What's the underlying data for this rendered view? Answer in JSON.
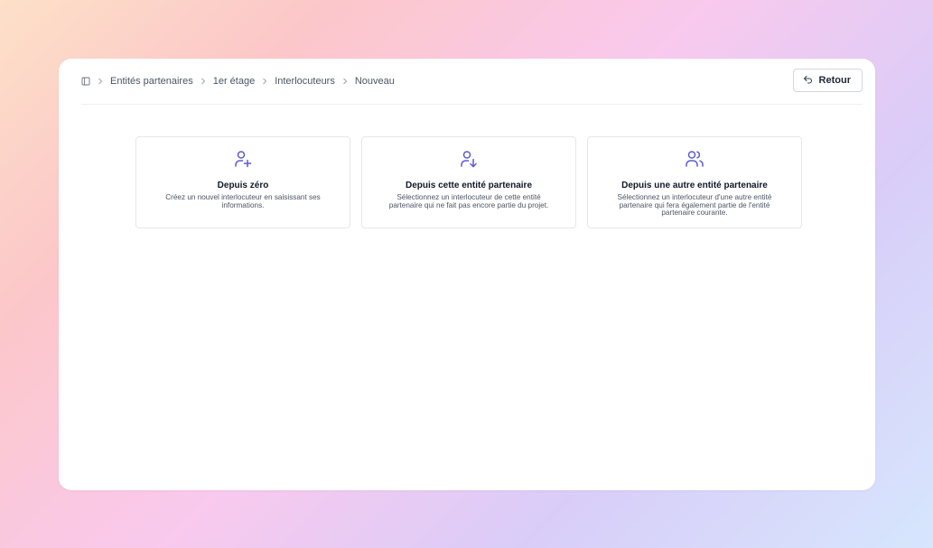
{
  "breadcrumb": {
    "home_icon": "panel-icon",
    "items": [
      "Entités partenaires",
      "1er étage",
      "Interlocuteurs",
      "Nouveau"
    ]
  },
  "back_button": {
    "label": "Retour",
    "icon": "undo-arrow-icon"
  },
  "options": [
    {
      "icon": "user-plus-icon",
      "title": "Depuis zéro",
      "description": "Créez un nouvel interlocuteur en saisissant ses informations."
    },
    {
      "icon": "user-down-arrow-icon",
      "title": "Depuis cette entité partenaire",
      "description": "Sélectionnez un interlocuteur de cette entité partenaire qui ne fait pas encore partie du projet."
    },
    {
      "icon": "users-icon",
      "title": "Depuis une autre entité partenaire",
      "description": "Sélectionnez un interlocuteur d'une autre entité partenaire qui fera également partie de l'entité partenaire courante."
    }
  ],
  "colors": {
    "accent": "#5b5bd6",
    "text": "#111827",
    "muted": "#4b5563"
  }
}
